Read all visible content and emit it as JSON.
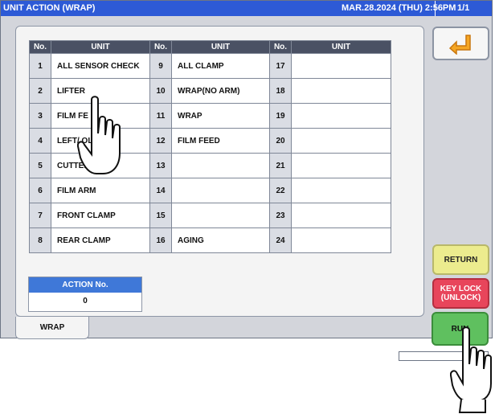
{
  "header": {
    "title": "UNIT ACTION (WRAP)",
    "datetime": "MAR.28.2024 (THU)  2:56PM",
    "page": "1/1"
  },
  "grid": {
    "col_no": "No.",
    "col_unit": "UNIT",
    "rows": [
      [
        {
          "no": "1",
          "unit": "ALL SENSOR CHECK"
        },
        {
          "no": "9",
          "unit": "ALL CLAMP"
        },
        {
          "no": "17",
          "unit": ""
        }
      ],
      [
        {
          "no": "2",
          "unit": "LIFTER"
        },
        {
          "no": "10",
          "unit": "WRAP(NO ARM)"
        },
        {
          "no": "18",
          "unit": ""
        }
      ],
      [
        {
          "no": "3",
          "unit": "FILM FE"
        },
        {
          "no": "11",
          "unit": "WRAP"
        },
        {
          "no": "19",
          "unit": ""
        }
      ],
      [
        {
          "no": "4",
          "unit": "LEFT/  OLDERS"
        },
        {
          "no": "12",
          "unit": "FILM FEED"
        },
        {
          "no": "20",
          "unit": ""
        }
      ],
      [
        {
          "no": "5",
          "unit": "CUTTER"
        },
        {
          "no": "13",
          "unit": ""
        },
        {
          "no": "21",
          "unit": ""
        }
      ],
      [
        {
          "no": "6",
          "unit": "FILM ARM"
        },
        {
          "no": "14",
          "unit": ""
        },
        {
          "no": "22",
          "unit": ""
        }
      ],
      [
        {
          "no": "7",
          "unit": "FRONT CLAMP"
        },
        {
          "no": "15",
          "unit": ""
        },
        {
          "no": "23",
          "unit": ""
        }
      ],
      [
        {
          "no": "8",
          "unit": "REAR CLAMP"
        },
        {
          "no": "16",
          "unit": "AGING"
        },
        {
          "no": "24",
          "unit": ""
        }
      ]
    ]
  },
  "action": {
    "label": "ACTION No.",
    "value": "0"
  },
  "tab": {
    "label": "WRAP"
  },
  "buttons": {
    "back_icon": "return-arrow-icon",
    "return": "RETURN",
    "keylock_line1": "KEY LOCK",
    "keylock_line2": "(UNLOCK)",
    "run": "RUN"
  },
  "colors": {
    "titlebar": "#2d5ad6",
    "header_cell": "#4a5164",
    "return": "#ecec8e",
    "keylock": "#e8455b",
    "run": "#5fc05f",
    "back_arrow": "#e8941a"
  }
}
